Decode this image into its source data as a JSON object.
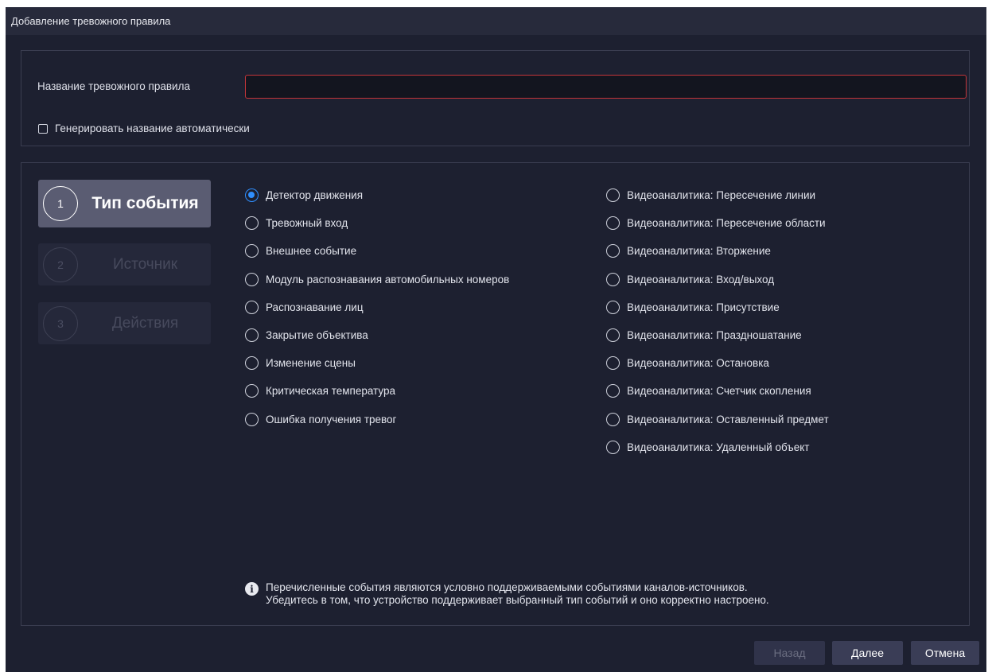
{
  "window": {
    "title": "Добавление тревожного правила"
  },
  "name_section": {
    "label": "Название тревожного правила",
    "value": "",
    "auto_generate_label": "Генерировать название автоматически",
    "auto_generate_checked": false
  },
  "steps": [
    {
      "number": "1",
      "label": "Тип события",
      "active": true
    },
    {
      "number": "2",
      "label": "Источник",
      "active": false
    },
    {
      "number": "3",
      "label": "Действия",
      "active": false
    }
  ],
  "event_types": {
    "selected": "Детектор движения",
    "left": [
      "Детектор движения",
      "Тревожный вход",
      "Внешнее событие",
      "Модуль распознавания автомобильных номеров",
      "Распознавание лиц",
      "Закрытие объектива",
      "Изменение сцены",
      "Критическая температура",
      "Ошибка получения тревог"
    ],
    "right": [
      "Видеоаналитика: Пересечение линии",
      "Видеоаналитика: Пересечение области",
      "Видеоаналитика: Вторжение",
      "Видеоаналитика: Вход/выход",
      "Видеоаналитика: Присутствие",
      "Видеоаналитика: Праздношатание",
      "Видеоаналитика: Остановка",
      "Видеоаналитика: Счетчик скопления",
      "Видеоаналитика: Оставленный предмет",
      "Видеоаналитика: Удаленный объект"
    ]
  },
  "info": {
    "icon": "info-icon",
    "line1": "Перечисленные события являются условно поддерживаемыми событиями каналов-источников.",
    "line2": "Убедитесь в том, что устройство поддерживает выбранный тип событий и оно корректно настроено."
  },
  "buttons": {
    "back": "Назад",
    "next": "Далее",
    "cancel": "Отмена"
  },
  "colors": {
    "background": "#1d2030",
    "accent": "#2f8fff",
    "error_border": "#c3353a"
  }
}
